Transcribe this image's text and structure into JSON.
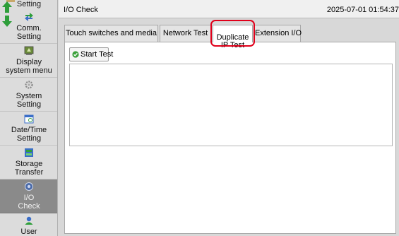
{
  "sidebar": {
    "items": [
      {
        "label": "Setting",
        "icon": "setting-icon"
      },
      {
        "label": "Comm.\nSetting",
        "icon": "comm-arrows-icon"
      },
      {
        "label": "Display\nsystem menu",
        "icon": "display-menu-icon"
      },
      {
        "label": "System\nSetting",
        "icon": "gear-icon"
      },
      {
        "label": "Date/Time\nSetting",
        "icon": "calendar-icon"
      },
      {
        "label": "Storage\nTransfer",
        "icon": "storage-transfer-icon"
      },
      {
        "label": "I/O\nCheck",
        "icon": "io-check-icon",
        "active": true
      },
      {
        "label": "User\nSettings",
        "icon": "user-icon"
      }
    ]
  },
  "header": {
    "title": "I/O Check",
    "datetime": "2025-07-01 01:54:37"
  },
  "tabs": [
    {
      "label": "Touch switches and media"
    },
    {
      "label": "Network Test"
    },
    {
      "label": "Duplicate\nIP Test",
      "active": true
    },
    {
      "label": "Extension I/O"
    }
  ],
  "main": {
    "start_button_label": "Start Test"
  },
  "colors": {
    "highlight": "#e0001a",
    "active_sidebar": "#8a8a8a",
    "button_check": "#3aa03a"
  }
}
